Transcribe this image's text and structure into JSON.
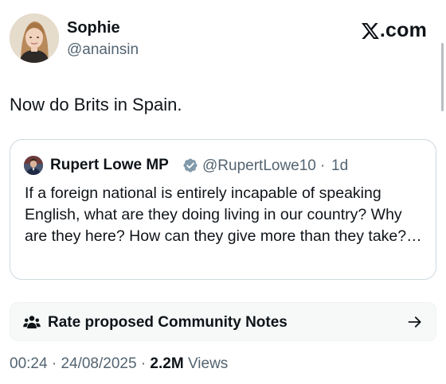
{
  "post": {
    "author_name": "Sophie",
    "author_handle": "@anainsin",
    "text": "Now do Brits in Spain.",
    "time": "00:24",
    "date": "24/08/2025",
    "views_count": "2.2M",
    "views_label": "Views"
  },
  "brand": {
    "domain": ".com",
    "icon": "x-logo-icon"
  },
  "quote": {
    "author_name": "Rupert Lowe MP",
    "author_handle": "@RupertLowe10",
    "time_ago": "1d",
    "verified_icon": "verified-badge-icon",
    "verified_color": "#829aab",
    "text": "If a foreign national is entirely incapable of speaking English, what are they doing living in our country? Why are they here? How can they give more than they take?…"
  },
  "community_notes": {
    "label": "Rate proposed Community Notes",
    "icon": "people-icon",
    "arrow_icon": "arrow-right-icon"
  },
  "separators": {
    "dot": "·"
  },
  "colors": {
    "text_primary": "#0f1419",
    "text_secondary": "#536471",
    "border": "#cfd9de",
    "notes_background": "#f7f9f9"
  }
}
